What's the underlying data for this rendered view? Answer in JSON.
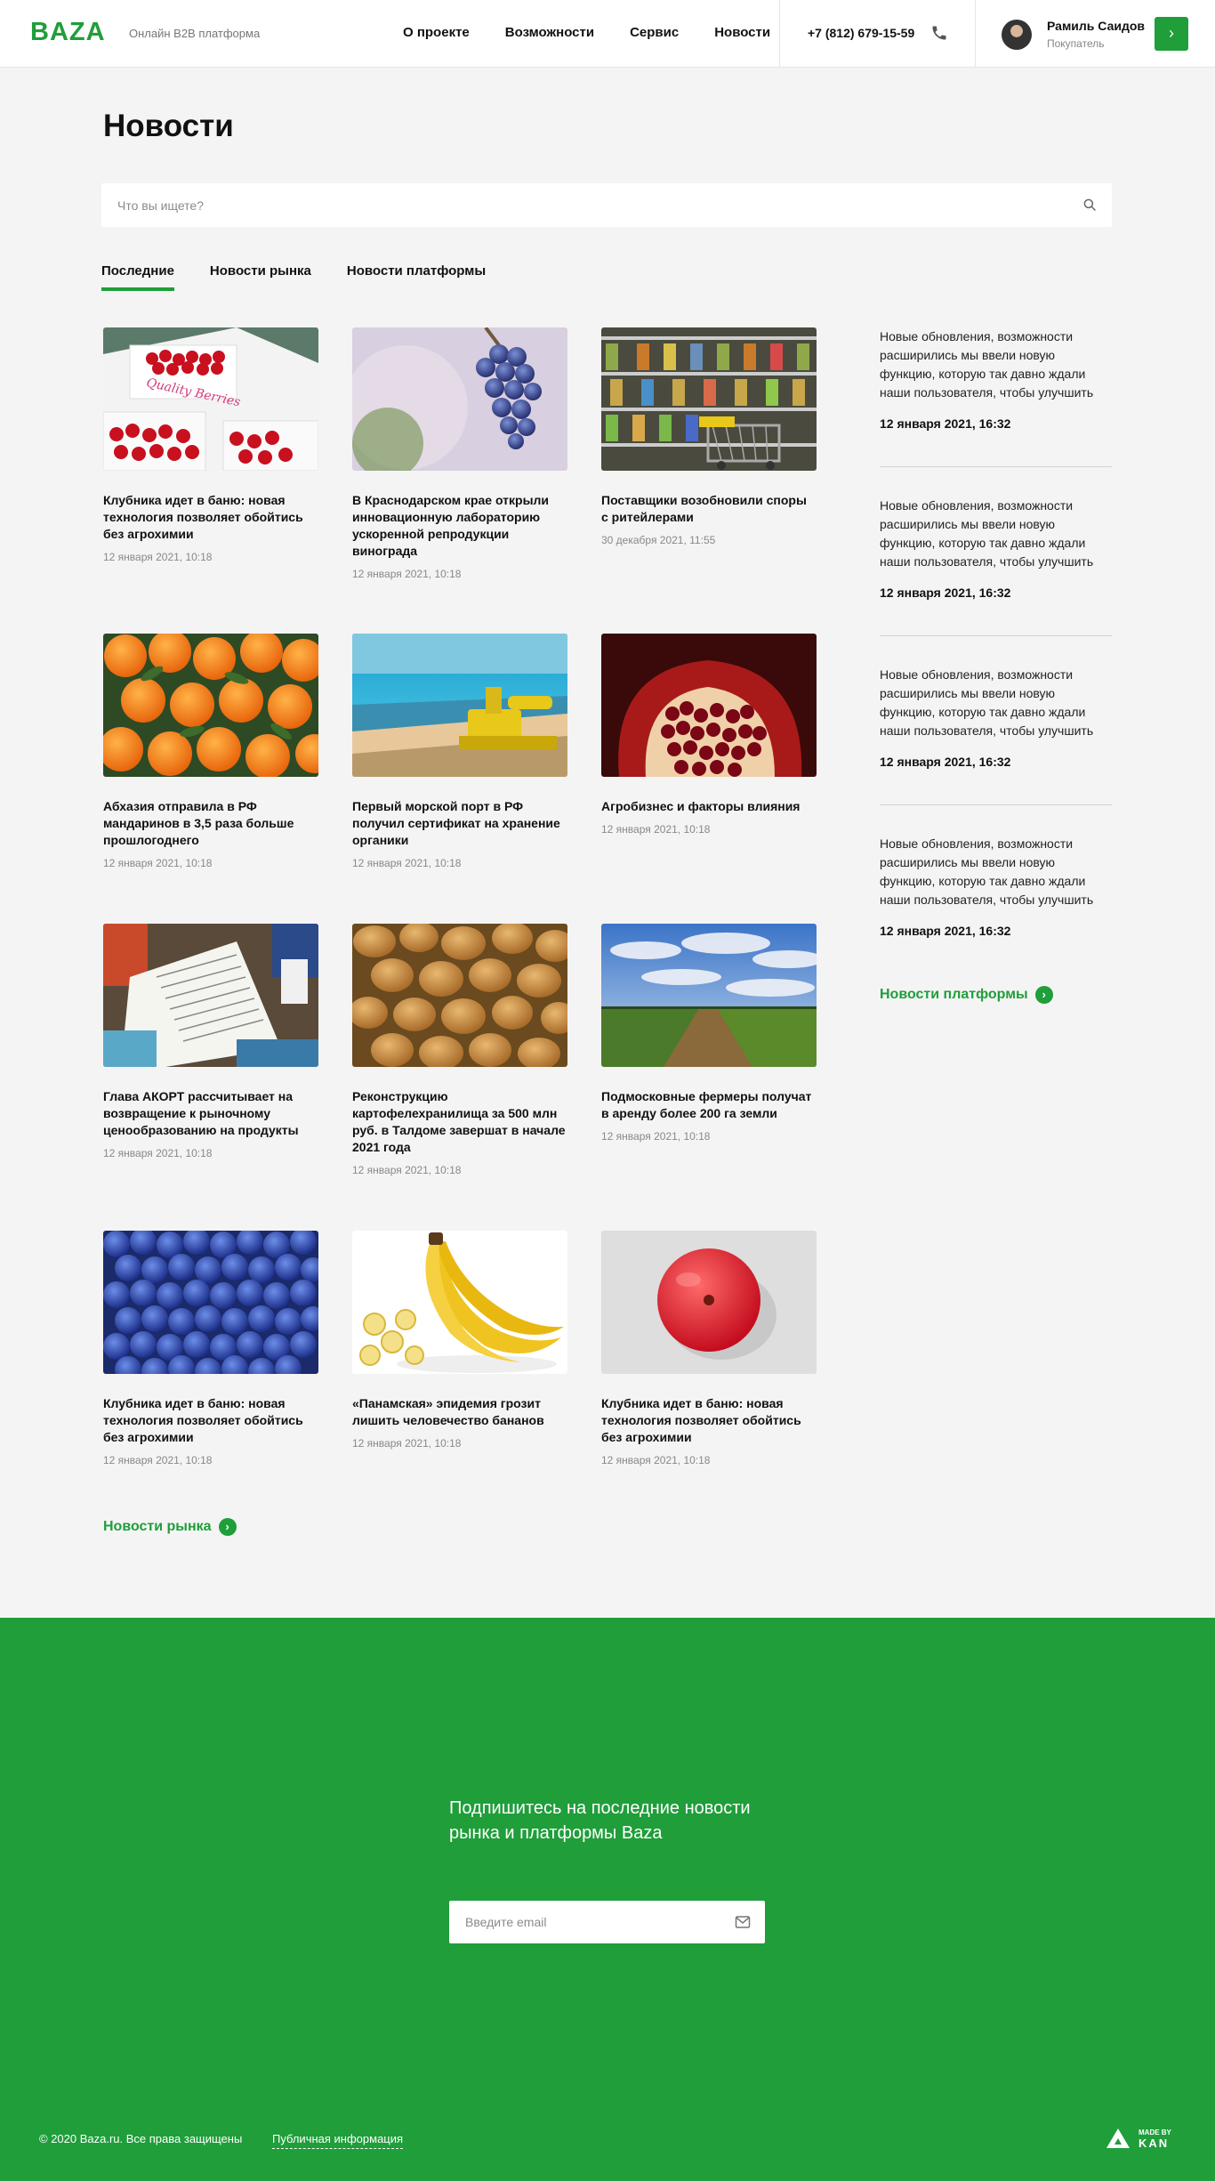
{
  "header": {
    "logo": "BAZA",
    "tagline": "Онлайн B2B платформа",
    "nav": [
      "О проекте",
      "Возможности",
      "Сервис",
      "Новости"
    ],
    "phone": "+7 (812) 679-15-59",
    "user_name": "Рамиль Саидов",
    "user_role": "Покупатель",
    "user_button_icon": "chevron-right-icon"
  },
  "page": {
    "title": "Новости",
    "search_placeholder": "Что вы ищете?"
  },
  "tabs": [
    "Последние",
    "Новости рынка",
    "Новости платформы"
  ],
  "cards": [
    {
      "title": "Клубника идет в баню: новая технология позволяет обойтись без агрохимии",
      "date": "12 января 2021, 10:18",
      "image": "strawberries"
    },
    {
      "title": "В Краснодарском крае открыли инновационную лабораторию ускоренной репродукции винограда",
      "date": "12 января 2021, 10:18",
      "image": "grapes"
    },
    {
      "title": "Поставщики возобновили споры с ритейлерами",
      "date": "30 декабря 2021, 11:55",
      "image": "supermarket"
    },
    {
      "title": "Абхазия отправила в РФ мандаринов в 3,5 раза больше прошлогоднего",
      "date": "12 января 2021, 10:18",
      "image": "tangerines"
    },
    {
      "title": "Первый морской порт в РФ получил сертификат на хранение органики",
      "date": "12 января 2021, 10:18",
      "image": "sea-port"
    },
    {
      "title": "Агробизнес и факторы влияния",
      "date": "12 января 2021, 10:18",
      "image": "pomegranate"
    },
    {
      "title": "Глава АКОРТ рассчитывает на возвращение к рыночному ценообразованию на продукты",
      "date": "12 января 2021, 10:18",
      "image": "receipt"
    },
    {
      "title": "Реконструкцию картофелехранилища за 500 млн руб. в Талдоме завершат в начале 2021 года",
      "date": "12 января 2021, 10:18",
      "image": "potatoes"
    },
    {
      "title": "Подмосковные фермеры получат в аренду более 200 га земли",
      "date": "12 января 2021, 10:18",
      "image": "field"
    },
    {
      "title": "Клубника идет в баню: новая технология позволяет обойтись без агрохимии",
      "date": "12 января 2021, 10:18",
      "image": "blueberries"
    },
    {
      "title": "«Панамская» эпидемия грозит лишить человечество бананов",
      "date": "12 января 2021, 10:18",
      "image": "bananas"
    },
    {
      "title": "Клубника идет в баню: новая технология позволяет обойтись без агрохимии",
      "date": "12 января 2021, 10:18",
      "image": "apple"
    }
  ],
  "market_link": "Новости рынка",
  "sidebar": {
    "items": [
      {
        "text": "Новые обновления, возможности расширились мы ввели новую функцию, которую так давно ждали наши пользователя, чтобы улучшить",
        "date": "12 января 2021, 16:32"
      },
      {
        "text": "Новые обновления, возможности расширились мы ввели новую функцию, которую так давно ждали наши пользователя, чтобы улучшить",
        "date": "12 января 2021, 16:32"
      },
      {
        "text": "Новые обновления, возможности расширились мы ввели новую функцию, которую так давно ждали наши пользователя, чтобы улучшить",
        "date": "12 января 2021, 16:32"
      },
      {
        "text": "Новые обновления, возможности расширились мы ввели новую функцию, которую так давно ждали наши пользователя, чтобы улучшить",
        "date": "12 января 2021, 16:32"
      }
    ],
    "link": "Новости платформы"
  },
  "footer": {
    "subscribe_text": "Подпишитесь на последние новости рынка и платформы Baza",
    "email_placeholder": "Введите email",
    "copyright": "© 2020 Baza.ru. Все права защищены",
    "public_info": "Публичная информация",
    "madeby_top": "MADE BY",
    "madeby_brand": "KAN"
  },
  "colors": {
    "accent": "#1f9e3a",
    "background": "#f4f4f4"
  }
}
